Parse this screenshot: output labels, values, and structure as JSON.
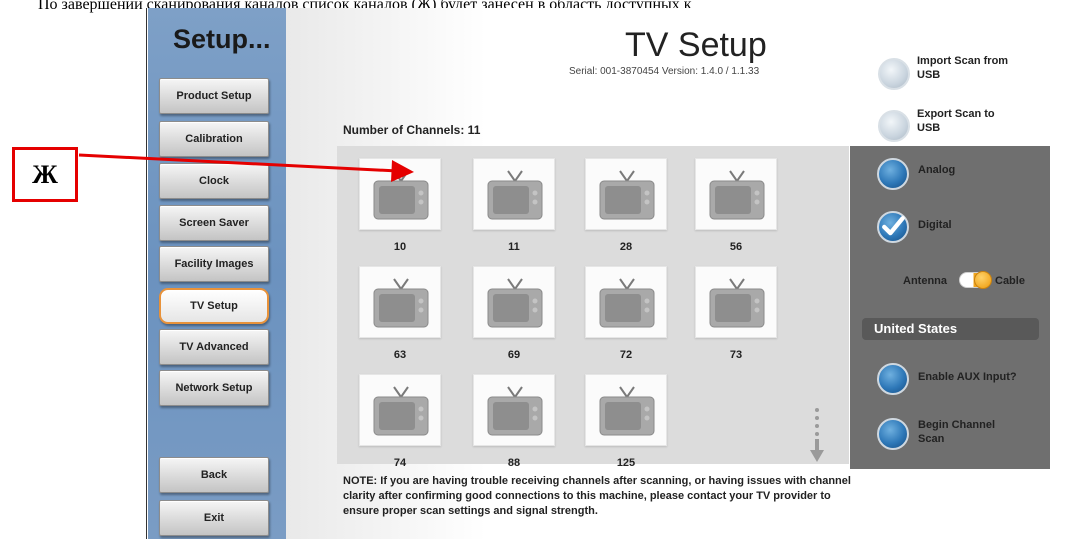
{
  "doc": {
    "caption": "По завершении сканирования каналов список каналов (Ж) будет занесен в область доступных к"
  },
  "sidebar": {
    "title": "Setup...",
    "items": [
      {
        "label": "Product Setup"
      },
      {
        "label": "Calibration"
      },
      {
        "label": "Clock"
      },
      {
        "label": "Screen Saver"
      },
      {
        "label": "Facility Images"
      },
      {
        "label": "TV Setup",
        "active": true
      },
      {
        "label": "TV Advanced"
      },
      {
        "label": "Network Setup"
      }
    ],
    "back_label": "Back",
    "exit_label": "Exit"
  },
  "main": {
    "title": "TV Setup",
    "serial": "Serial: 001-3870454  Version: 1.4.0 / 1.1.33",
    "channel_count": "Number of Channels: 11",
    "channels": [
      "10",
      "11",
      "28",
      "56",
      "63",
      "69",
      "72",
      "73",
      "74",
      "88",
      "125"
    ],
    "note": "NOTE: If you are having trouble receiving channels after scanning, or having issues with channel clarity after confirming good connections to this machine, please contact your TV provider to ensure proper scan settings and signal strength."
  },
  "right": {
    "import_label": "Import Scan from USB",
    "export_label": "Export Scan to USB",
    "analog_label": "Analog",
    "digital_label": "Digital",
    "digital_checked": true,
    "antenna_label": "Antenna",
    "cable_label": "Cable",
    "toggle_selected": "Cable",
    "region": "United States",
    "aux_label": "Enable AUX Input?",
    "scan_label": "Begin Channel Scan"
  },
  "annotation": {
    "letter": "Ж",
    "color": "#e50000"
  },
  "colors": {
    "sidebar_blue": "#7ea0c7",
    "accent_orange": "#e8923a",
    "panel_gray": "#6f6f6f",
    "button_blue": "#2e78b8"
  }
}
